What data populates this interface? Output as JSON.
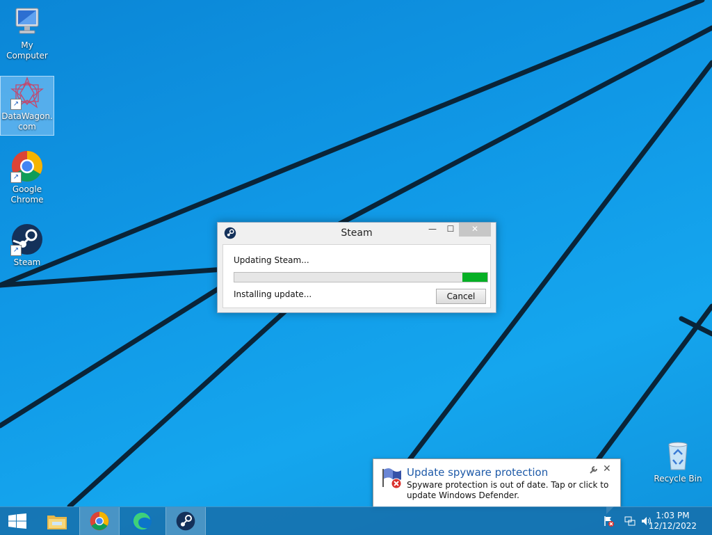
{
  "desktop": {
    "icons": [
      {
        "label": "My Computer"
      },
      {
        "label": "DataWagon.com"
      },
      {
        "label": "Google Chrome"
      },
      {
        "label": "Steam"
      },
      {
        "label": "Recycle Bin"
      }
    ]
  },
  "steam_dialog": {
    "title": "Steam",
    "status_top": "Updating Steam...",
    "status_bottom": "Installing update...",
    "progress_percent": 90,
    "cancel_label": "Cancel",
    "minimize_glyph": "—",
    "maximize_glyph": "☐",
    "close_glyph": "✕"
  },
  "notification": {
    "title": "Update spyware protection",
    "body": "Spyware protection is out of date. Tap or click to update Windows Defender.",
    "close_glyph": "✕",
    "settings_glyph": "🔧"
  },
  "taskbar": {
    "clock_time": "1:03 PM",
    "clock_date": "12/12/2022",
    "buttons": [
      "start",
      "file-explorer",
      "chrome",
      "edge",
      "steam"
    ]
  },
  "colors": {
    "wallpaper": "#1098e6",
    "progress_fill": "#06b025",
    "balloon_title": "#1e5aa8"
  }
}
